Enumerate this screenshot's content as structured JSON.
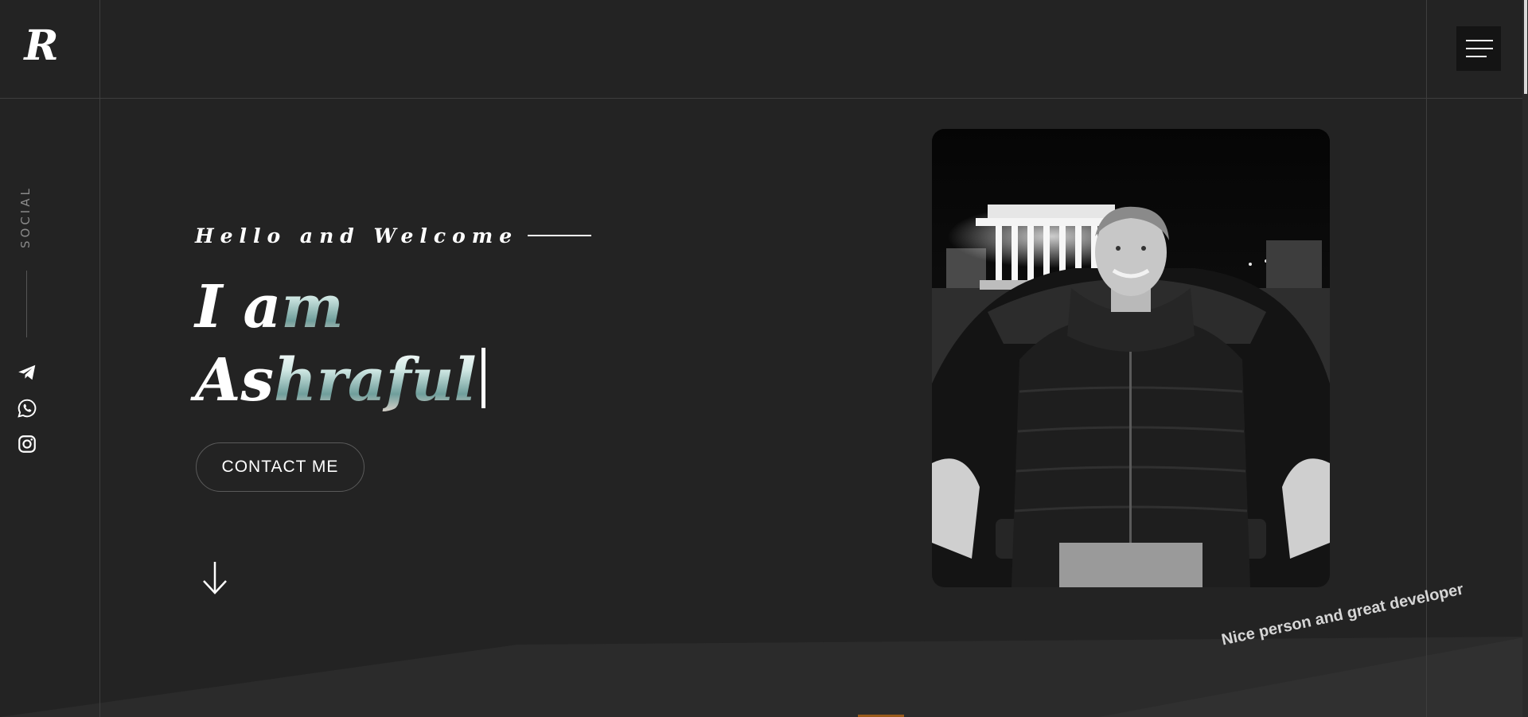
{
  "brand": {
    "logo_letter": "R"
  },
  "menu": {
    "icon": "hamburger-menu-icon"
  },
  "social": {
    "label": "SOCIAL",
    "links": [
      {
        "name": "telegram",
        "icon": "telegram-icon"
      },
      {
        "name": "whatsapp",
        "icon": "whatsapp-icon"
      },
      {
        "name": "instagram",
        "icon": "instagram-icon"
      }
    ]
  },
  "hero": {
    "greeting": "Hello and Welcome",
    "line1_plain": "I a",
    "line1_tint": "m",
    "line2_plain": "As",
    "line2_tint": "hraful",
    "cta_label": "CONTACT ME",
    "scroll_icon": "arrow-down-icon"
  },
  "photo": {
    "description_icon": "profile-photo"
  },
  "tagline": "Nice person and great developer",
  "colors": {
    "background": "#232323",
    "panel_dark": "#141414",
    "line": "#3e3e3e",
    "text": "#ffffff",
    "muted": "#8a8a8a"
  }
}
